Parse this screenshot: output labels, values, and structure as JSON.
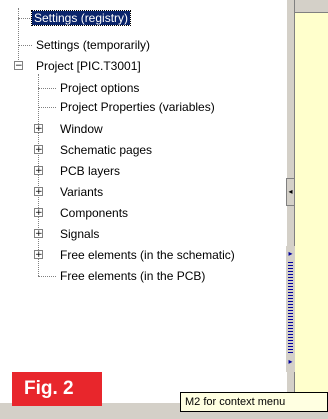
{
  "tree": {
    "items": [
      {
        "label": "Settings (registry)",
        "selected": true
      },
      {
        "label": "Settings (temporarily)"
      },
      {
        "label": "Project [PIC.T3001]",
        "expander": "−"
      },
      {
        "label": "Project options"
      },
      {
        "label": "Project Properties (variables)"
      },
      {
        "label": "Window",
        "expander": "+"
      },
      {
        "label": "Schematic pages",
        "expander": "+"
      },
      {
        "label": "PCB layers",
        "expander": "+"
      },
      {
        "label": "Variants",
        "expander": "+"
      },
      {
        "label": "Components",
        "expander": "+"
      },
      {
        "label": "Signals",
        "expander": "+"
      },
      {
        "label": "Free elements (in the schematic)",
        "expander": "+"
      },
      {
        "label": "Free elements (in the PCB)"
      }
    ]
  },
  "splitter": {
    "collapse_glyph": "◂"
  },
  "scroll": {
    "up_glyph": "▸",
    "down_glyph": "▸"
  },
  "tooltip": {
    "text": "M2 for context menu"
  },
  "figure_label": "Fig. 2",
  "colors": {
    "selection": "#0a246a",
    "fig_badge": "#e8262c",
    "pane_bg": "#ffffcc",
    "tooltip_bg": "#ffffe1"
  }
}
